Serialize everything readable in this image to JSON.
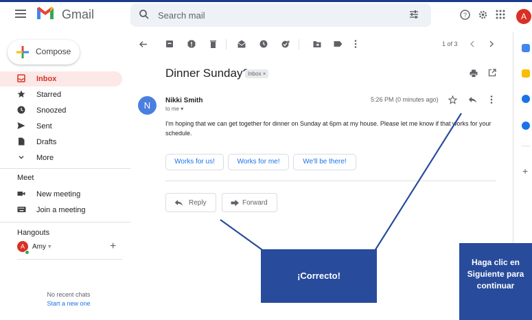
{
  "header": {
    "app_name": "Gmail",
    "search_placeholder": "Search mail",
    "avatar_letter": "A"
  },
  "sidebar": {
    "compose_label": "Compose",
    "items": [
      {
        "label": "Inbox",
        "icon": "inbox-icon"
      },
      {
        "label": "Starred",
        "icon": "star-icon"
      },
      {
        "label": "Snoozed",
        "icon": "clock-icon"
      },
      {
        "label": "Sent",
        "icon": "send-icon"
      },
      {
        "label": "Drafts",
        "icon": "draft-icon"
      },
      {
        "label": "More",
        "icon": "chevron-down-icon"
      }
    ],
    "meet": {
      "title": "Meet",
      "items": [
        {
          "label": "New meeting",
          "icon": "video-icon"
        },
        {
          "label": "Join a meeting",
          "icon": "keyboard-icon"
        }
      ]
    },
    "hangouts": {
      "title": "Hangouts",
      "user_name": "Amy",
      "user_letter": "A",
      "no_chats": "No recent chats",
      "start_new": "Start a new one"
    }
  },
  "toolbar": {
    "pager": "1 of 3"
  },
  "email": {
    "subject": "Dinner Sunday?",
    "label_chip": "Inbox ×",
    "sender_name": "Nikki Smith",
    "sender_letter": "N",
    "to": "to me",
    "time": "5:26 PM (0 minutes ago)",
    "body": "I'm hoping that we can get together for dinner on Sunday at 6pm at my house. Please let me know if that works for your schedule.",
    "smart_replies": [
      "Works for us!",
      "Works for me!",
      "We'll be there!"
    ],
    "reply_label": "Reply",
    "forward_label": "Forward"
  },
  "overlay": {
    "correct_text": "¡Correcto!",
    "next_text": "Haga clic en Siguiente para continuar",
    "color": "#284b9b"
  },
  "colors": {
    "accent_red": "#d93025",
    "link_blue": "#1a73e8",
    "inbox_active_bg": "#fce8e6"
  }
}
